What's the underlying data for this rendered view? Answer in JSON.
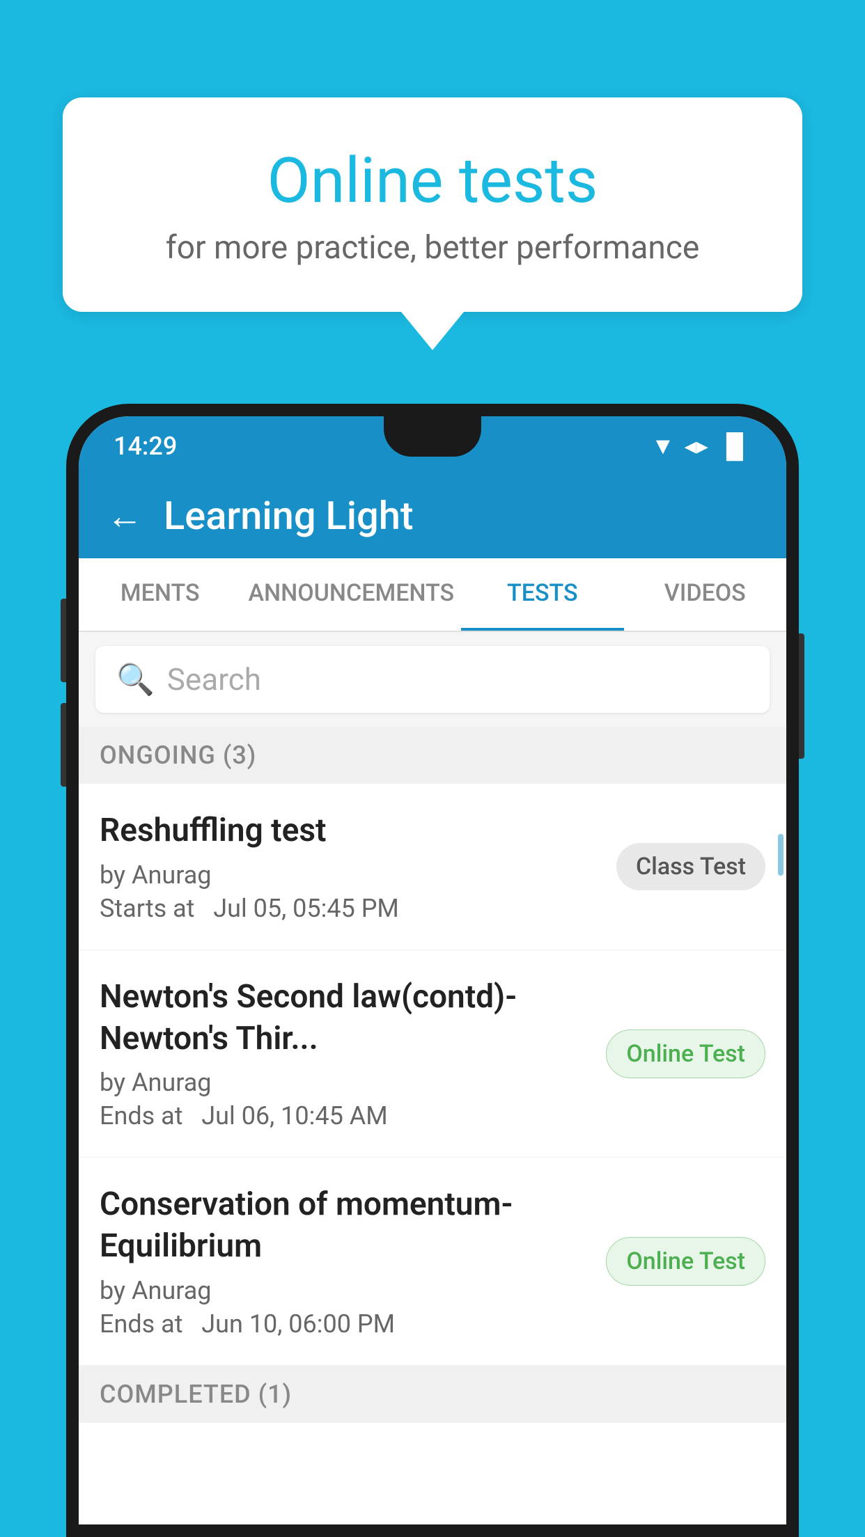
{
  "background_color": "#1BB8E0",
  "bubble": {
    "title": "Online tests",
    "subtitle": "for more practice, better performance"
  },
  "status_bar": {
    "time": "14:29",
    "wifi": "▼",
    "signal": "▲",
    "battery": "▐"
  },
  "app_bar": {
    "title": "Learning Light",
    "back_label": "←"
  },
  "tabs": [
    {
      "label": "MENTS",
      "active": false
    },
    {
      "label": "ANNOUNCEMENTS",
      "active": false
    },
    {
      "label": "TESTS",
      "active": true
    },
    {
      "label": "VIDEOS",
      "active": false
    }
  ],
  "search": {
    "placeholder": "Search"
  },
  "ongoing_section": {
    "label": "ONGOING (3)"
  },
  "tests": [
    {
      "title": "Reshuffling test",
      "author": "by Anurag",
      "time_label": "Starts at",
      "time": "Jul 05, 05:45 PM",
      "badge": "Class Test",
      "badge_type": "class"
    },
    {
      "title": "Newton's Second law(contd)-Newton's Thir...",
      "author": "by Anurag",
      "time_label": "Ends at",
      "time": "Jul 06, 10:45 AM",
      "badge": "Online Test",
      "badge_type": "online"
    },
    {
      "title": "Conservation of momentum-Equilibrium",
      "author": "by Anurag",
      "time_label": "Ends at",
      "time": "Jun 10, 06:00 PM",
      "badge": "Online Test",
      "badge_type": "online"
    }
  ],
  "completed_section": {
    "label": "COMPLETED (1)"
  }
}
